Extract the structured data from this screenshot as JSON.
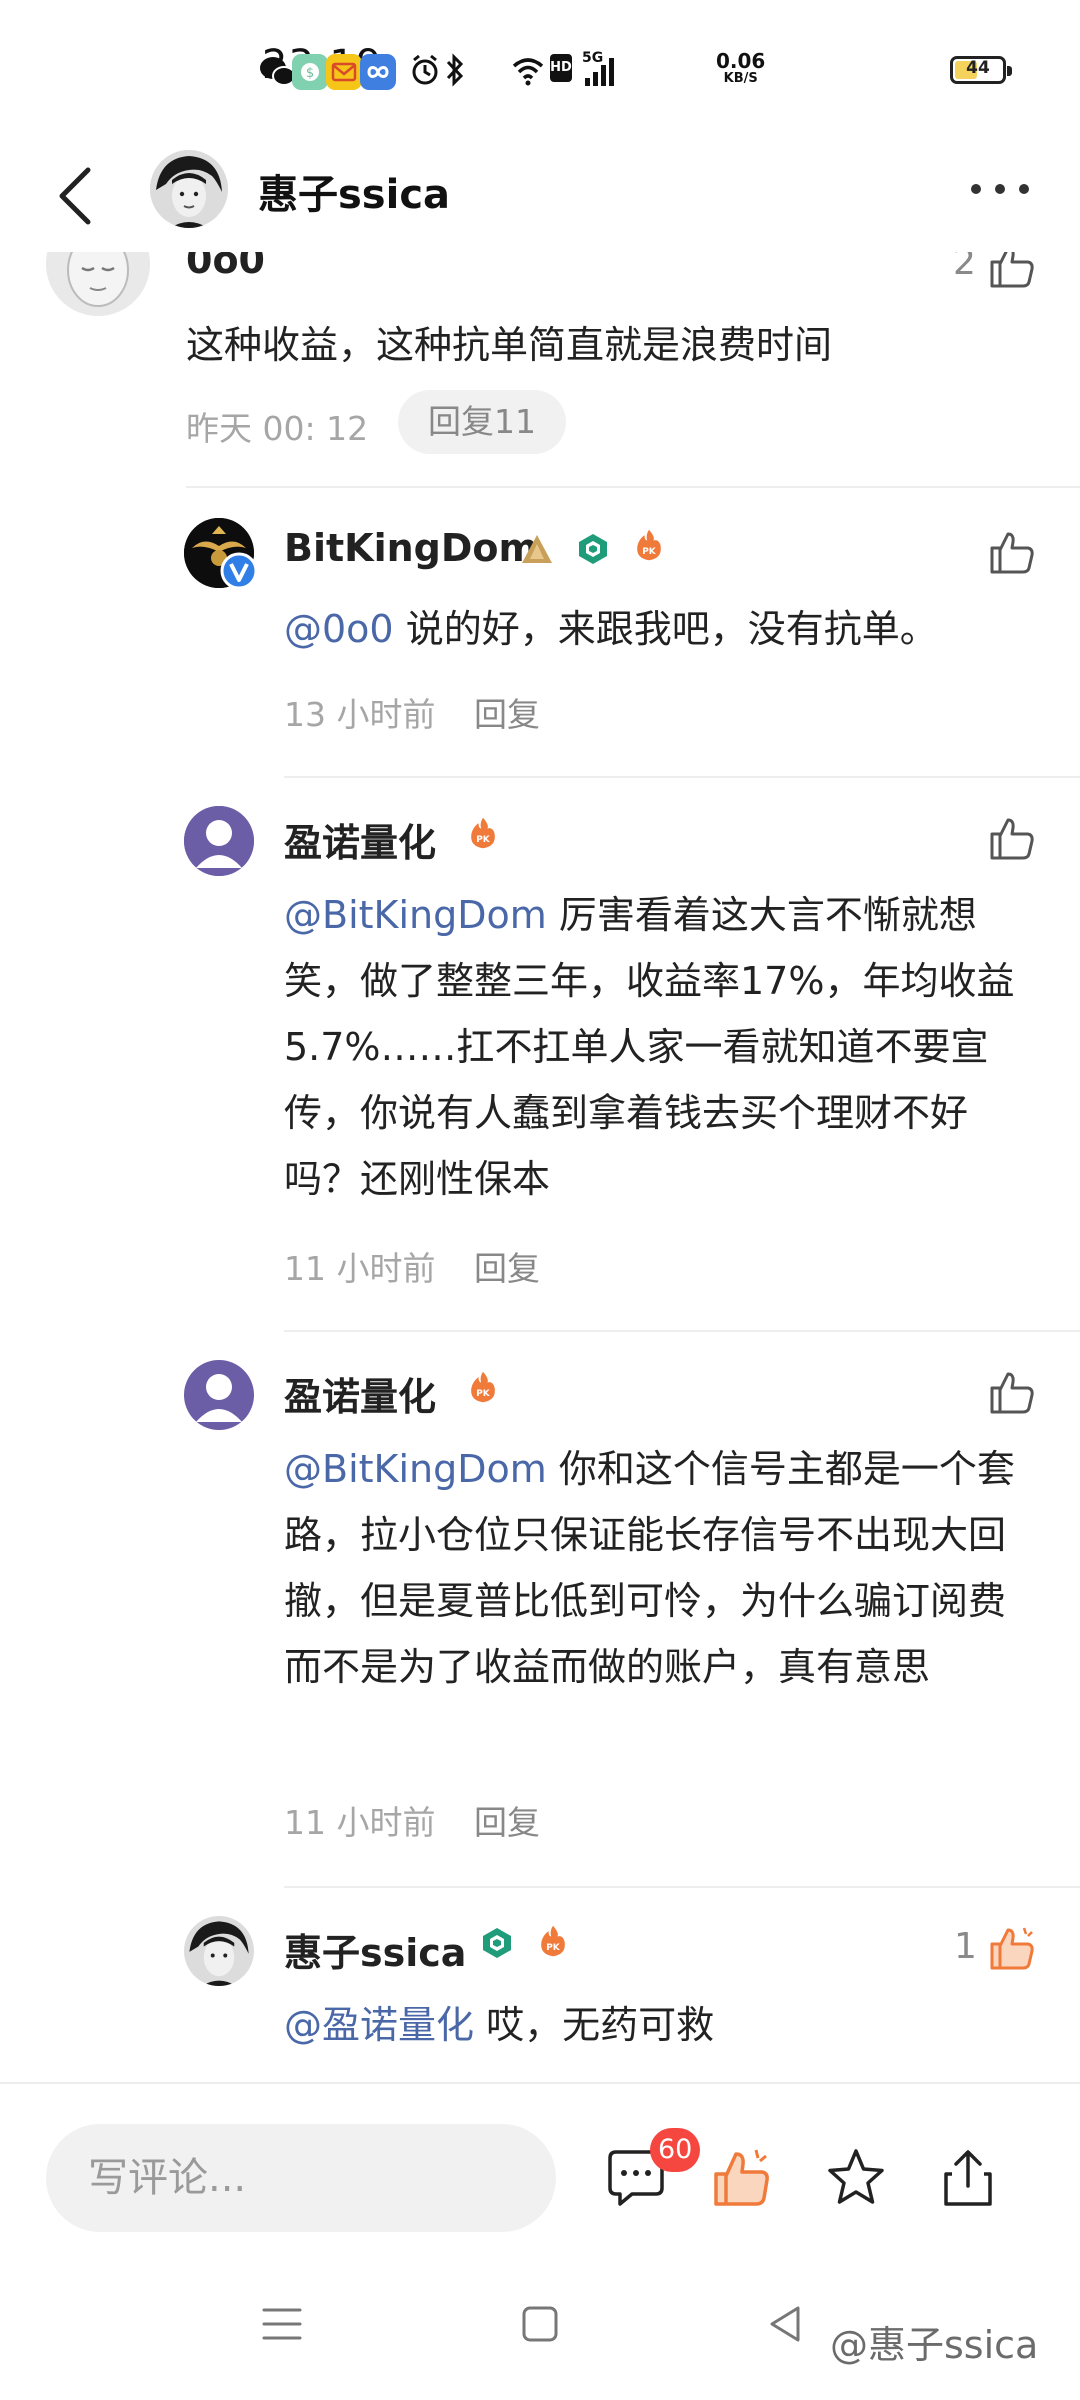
{
  "status_bar": {
    "time": "23:19",
    "net_speed_value": "0.06",
    "net_speed_unit": "KB/S",
    "network": "5G",
    "hd_label": "HD",
    "battery_level": "44",
    "icons": [
      "wechat-icon",
      "money-app-icon",
      "mail-app-icon",
      "infinity-app-icon",
      "alarm-icon",
      "bluetooth-icon",
      "wifi-icon",
      "hd-icon",
      "signal-icon",
      "battery-icon"
    ]
  },
  "header": {
    "title": "惠子ssica"
  },
  "comments": [
    {
      "username": "0o0",
      "text": "这种收益，这种抗单简直就是浪费时间",
      "time": "昨天 00: 12",
      "reply_label": "回复11",
      "like_count": "2"
    },
    {
      "username": "BitKingDom",
      "mention": "@0o0",
      "text": " 说的好，来跟我吧，没有抗单。",
      "time": "13 小时前",
      "reply_label": "回复"
    },
    {
      "username": "盈诺量化",
      "mention": "@BitKingDom",
      "text": " 厉害看着这大言不惭就想笑，做了整整三年，收益率17%，年均收益5.7%……扛不扛单人家一看就知道不要宣传，你说有人蠢到拿着钱去买个理财不好吗？还刚性保本",
      "time": "11 小时前",
      "reply_label": "回复"
    },
    {
      "username": "盈诺量化",
      "mention": "@BitKingDom",
      "text": " 你和这个信号主都是一个套路，拉小仓位只保证能长存信号不出现大回撤，但是夏普比低到可怜，为什么骗订阅费而不是为了收益而做的账户，真有意思",
      "time": "11 小时前",
      "reply_label": "回复"
    },
    {
      "username": "惠子ssica",
      "mention": "@盈诺量化",
      "text": " 哎，无药可救",
      "like_count": "1"
    }
  ],
  "bottom_bar": {
    "input_placeholder": "写评论...",
    "comment_count": "60"
  },
  "watermark": "@惠子ssica",
  "colors": {
    "mention": "#4a68a8",
    "pk_badge": "#f07a3a",
    "liked": "#f07a3a",
    "count_badge": "#f5463f"
  }
}
